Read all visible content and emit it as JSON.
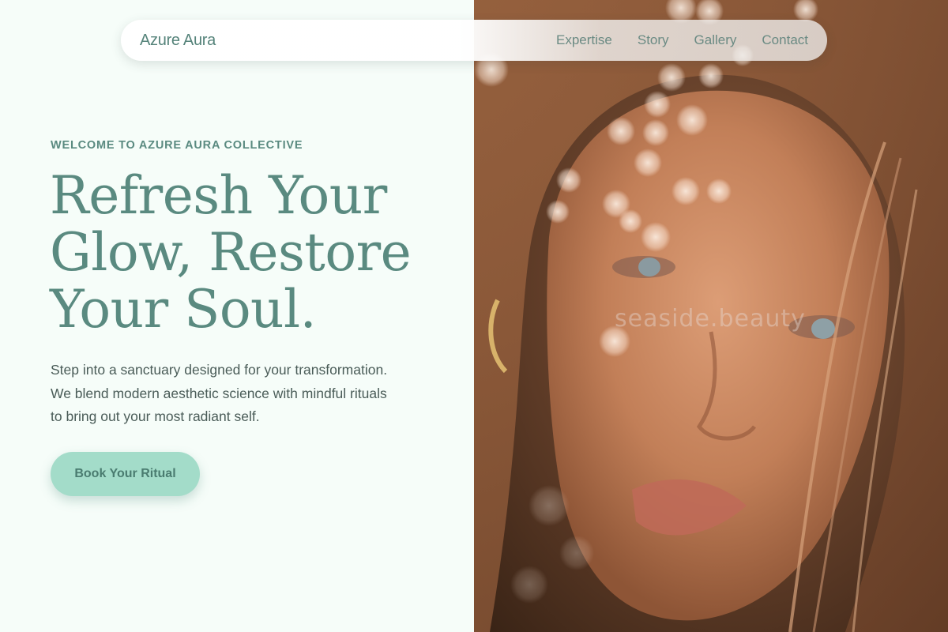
{
  "brand": {
    "name": "Azure Aura"
  },
  "nav": {
    "links": [
      {
        "label": "Expertise"
      },
      {
        "label": "Story"
      },
      {
        "label": "Gallery"
      },
      {
        "label": "Contact"
      }
    ]
  },
  "hero": {
    "eyebrow": "WELCOME TO AZURE AURA COLLECTIVE",
    "headline_lines": [
      "Refresh Your",
      "Glow, Restore",
      "Your Soul."
    ],
    "body_lines": [
      "Step into a sanctuary designed for your transformation.",
      "We blend modern aesthetic science with mindful rituals",
      "to bring out your most radiant self."
    ],
    "cta_label": "Book Your Ritual",
    "image_watermark": "seaside.beauty"
  },
  "colors": {
    "accent": "#5a8a80",
    "button": "#a3dcc9",
    "background": "#f6fdf9"
  }
}
